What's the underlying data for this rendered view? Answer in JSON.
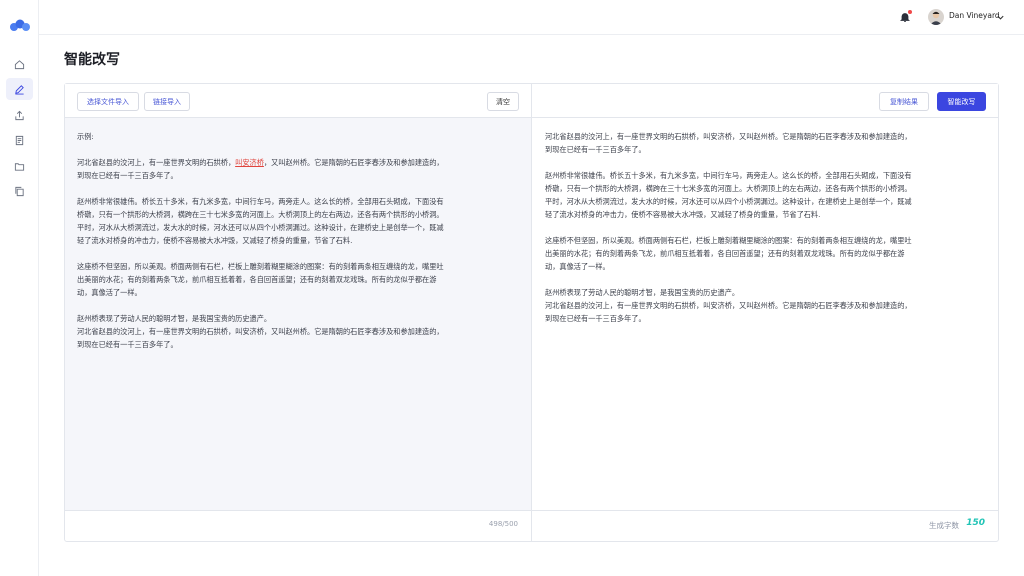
{
  "header": {
    "user_name": "Dan Vineyard"
  },
  "nav": {
    "items": [
      {
        "icon": "home-icon"
      },
      {
        "icon": "edit-icon",
        "active": true
      },
      {
        "icon": "upload-icon"
      },
      {
        "icon": "document-icon"
      },
      {
        "icon": "folder-icon"
      },
      {
        "icon": "copy-icon"
      }
    ]
  },
  "page": {
    "title": "智能改写"
  },
  "editor": {
    "import_file_label": "选择文件导入",
    "import_link_label": "链接导入",
    "clear_label": "清空",
    "example_label": "示例:",
    "p1_before": "河北省赵县的洨河上，有一座世界文明的石拱桥，",
    "p1_highlight": "叫安济桥",
    "p1_after": "，又叫赵州桥。它是隋朝的石匠李春涉及和参加建造的，\n到现在已经有一千三百多年了。",
    "p2": "赵州桥非常很雄伟。桥长五十多米，有九米多宽，中间行车马，两旁走人。这么长的桥，全部用石头砌成，下面没有\n桥礅，只有一个拱形的大桥洞，横跨在三十七米多宽的河面上。大桥洞顶上的左右两边，还各有两个拱形的小桥洞。\n平时，河水从大桥洞流过，发大水的时候，河水还可以从四个小桥洞漏过。这种设计，在建桥史上是创举一个，既减\n轻了流水对桥身的冲击力，使桥不容易被大水冲毁，又减轻了桥身的重量，节省了石料.",
    "p3": "这座桥不但坚固，所以美观。桥面两侧有石栏，栏板上雕刻着糊里糊涂的图案：有的刻着两条相互缠绕的龙，嘴里吐\n出美丽的水花；有的刻着两条飞龙，前爪相互抵着着，各自回首遥望；还有的刻着双龙戏珠。所有的龙似乎都在游\n动，真像活了一样。",
    "p4": "赵州桥表现了劳动人民的聪明才智，是我国宝贵的历史遗产。\n河北省赵县的洨河上，有一座世界文明的石拱桥，叫安济桥，又叫赵州桥。它是隋朝的石匠李春涉及和参加建造的，\n到现在已经有一千三百多年了。",
    "char_count": "498/500"
  },
  "result": {
    "copy_label": "复制结果",
    "rewrite_label": "智能改写",
    "p1": "河北省赵县的洨河上，有一座世界文明的石拱桥，叫安济桥，又叫赵州桥。它是隋朝的石匠李春涉及和参加建造的，\n到现在已经有一千三百多年了。",
    "p2": "赵州桥非常很雄伟。桥长五十多米，有九米多宽，中间行车马，两旁走人。这么长的桥，全部用石头砌成，下面没有\n桥礅，只有一个拱形的大桥洞，横跨在三十七米多宽的河面上。大桥洞顶上的左右两边，还各有两个拱形的小桥洞。\n平时，河水从大桥洞流过，发大水的时候，河水还可以从四个小桥洞漏过。这种设计，在建桥史上是创举一个，既减\n轻了流水对桥身的冲击力，使桥不容易被大水冲毁，又减轻了桥身的重量，节省了石料.",
    "p3": "这座桥不但坚固，所以美观。桥面两侧有石栏，栏板上雕刻着糊里糊涂的图案：有的刻着两条相互缠绕的龙，嘴里吐\n出美丽的水花；有的刻着两条飞龙，前爪相互抵着着，各自回首遥望；还有的刻着双龙戏珠。所有的龙似乎都在游\n动，真像活了一样。",
    "p4": "赵州桥表现了劳动人民的聪明才智，是我国宝贵的历史遗产。\n河北省赵县的洨河上，有一座世界文明的石拱桥，叫安济桥，又叫赵州桥。它是隋朝的石匠李春涉及和参加建造的，\n到现在已经有一千三百多年了。",
    "gen_label": "生成字数",
    "gen_count": "150"
  }
}
